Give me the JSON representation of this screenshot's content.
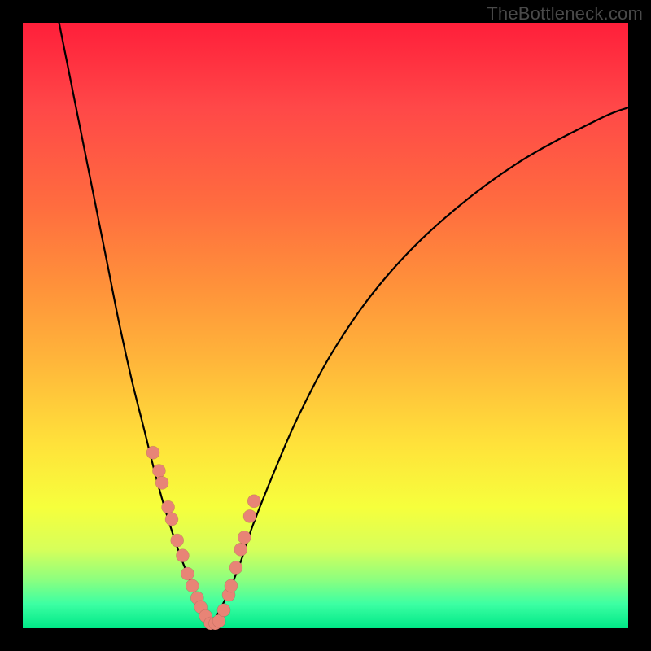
{
  "watermark": "TheBottleneck.com",
  "colors": {
    "frame": "#000000",
    "curve": "#000000",
    "marker": "#e88476",
    "gradient_stops": [
      "#ff1f3a",
      "#ff4848",
      "#ff933a",
      "#ffe33a",
      "#d7ff5a",
      "#00e887"
    ]
  },
  "chart_data": {
    "type": "line",
    "title": "",
    "xlabel": "",
    "ylabel": "",
    "xlim": [
      0,
      100
    ],
    "ylim": [
      0,
      100
    ],
    "grid": false,
    "series": [
      {
        "name": "left-curve",
        "x": [
          6,
          8,
          10,
          12,
          14,
          16,
          18,
          20,
          22,
          24,
          26,
          28,
          29,
          30,
          31
        ],
        "values": [
          100,
          90,
          80,
          70,
          60,
          50,
          41,
          33,
          25,
          18,
          12,
          7,
          4,
          2,
          0.5
        ]
      },
      {
        "name": "right-curve",
        "x": [
          31,
          32,
          34,
          36,
          38,
          42,
          46,
          52,
          60,
          70,
          82,
          95,
          100
        ],
        "values": [
          0.5,
          2,
          6,
          11,
          17,
          27,
          36,
          47,
          58,
          68,
          77,
          84,
          86
        ]
      }
    ],
    "markers": {
      "name": "highlight-points",
      "x": [
        21.5,
        22.5,
        23.0,
        24.0,
        24.6,
        25.5,
        26.4,
        27.2,
        28.0,
        28.8,
        29.4,
        30.2,
        31.0,
        31.8,
        32.4,
        33.2,
        34.0,
        34.4,
        35.2,
        36.0,
        36.6,
        37.5,
        38.2
      ],
      "values": [
        29.0,
        26.0,
        24.0,
        20.0,
        18.0,
        14.5,
        12.0,
        9.0,
        7.0,
        5.0,
        3.5,
        2.0,
        0.8,
        0.8,
        1.2,
        3.0,
        5.5,
        7.0,
        10.0,
        13.0,
        15.0,
        18.5,
        21.0
      ]
    }
  }
}
